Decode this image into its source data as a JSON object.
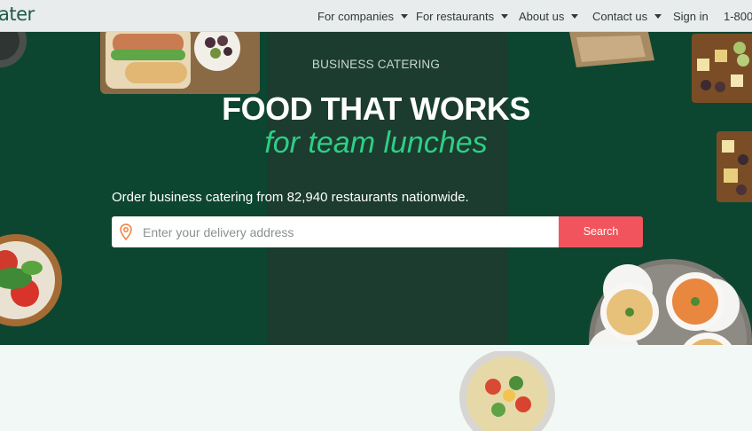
{
  "brand": {
    "logo_text": "ater"
  },
  "nav": {
    "items": [
      {
        "label": "For companies"
      },
      {
        "label": "For restaurants"
      },
      {
        "label": "About us"
      },
      {
        "label": "Contact us"
      }
    ],
    "sign_in": "Sign in",
    "phone": "1-800"
  },
  "hero": {
    "eyebrow": "BUSINESS CATERING",
    "headline": "FOOD THAT WORKS",
    "subheadline": "for team lunches",
    "lead": "Order business catering from 82,940 restaurants nationwide.",
    "search": {
      "placeholder": "Enter your delivery address",
      "value": "",
      "button_label": "Search"
    }
  },
  "colors": {
    "hero_bg": "#0d4630",
    "hero_band": "#1b3c2e",
    "accent_green": "#2ecf86",
    "search_button": "#f1545c",
    "pin_orange": "#f0803c"
  },
  "icons": [
    "location-pin-icon",
    "chevron-down-icon"
  ]
}
